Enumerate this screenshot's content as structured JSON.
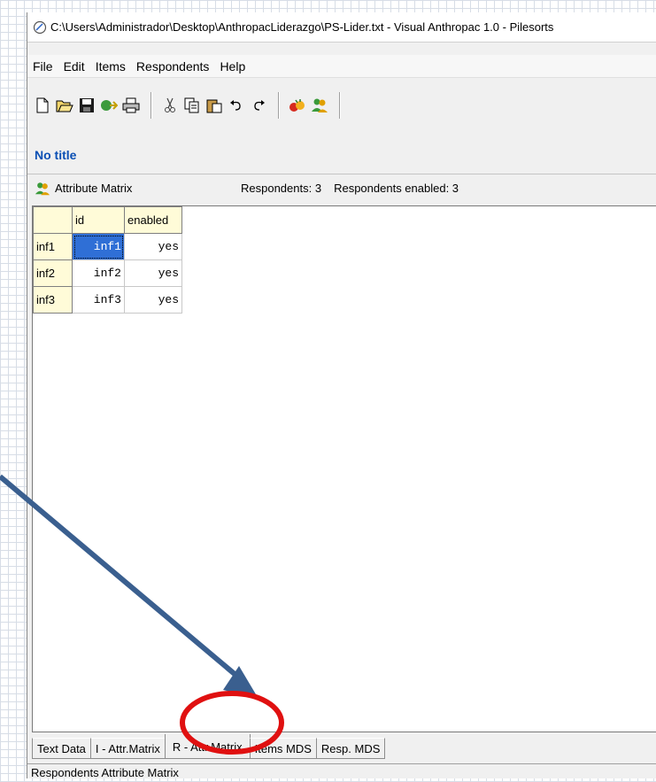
{
  "window": {
    "title": "C:\\Users\\Administrador\\Desktop\\AnthropacLiderazgo\\PS-Lider.txt - Visual Anthropac 1.0 - Pilesorts"
  },
  "menu": [
    "File",
    "Edit",
    "Items",
    "Respondents",
    "Help"
  ],
  "toolbar": {
    "buttons": [
      "new-file-icon",
      "open-folder-icon",
      "save-icon",
      "import-icon",
      "print-icon",
      "cut-icon",
      "copy-icon",
      "paste-icon",
      "undo-icon",
      "redo-icon",
      "items-icon",
      "respondents-icon"
    ]
  },
  "document": {
    "title": "No title"
  },
  "panel": {
    "title": "Attribute Matrix",
    "respondents": "Respondents: 3",
    "respondents_enabled": "Respondents enabled: 3"
  },
  "grid": {
    "columns": [
      "id",
      "enabled"
    ],
    "rows": [
      {
        "header": "inf1",
        "id": "inf1",
        "enabled": "yes"
      },
      {
        "header": "inf2",
        "id": "inf2",
        "enabled": "yes"
      },
      {
        "header": "inf3",
        "id": "inf3",
        "enabled": "yes"
      }
    ]
  },
  "tabs": [
    "Text Data",
    "I - Attr.Matrix",
    "R - Attr.Matrix",
    "Items MDS",
    "Resp. MDS"
  ],
  "active_tab": "R - Attr.Matrix",
  "status": "Respondents Attribute Matrix",
  "colors": {
    "accent_title": "#0a4fb4",
    "selection": "#2f6fd6",
    "annotation_arrow": "#3a5f8f",
    "annotation_circle": "#e01010"
  }
}
